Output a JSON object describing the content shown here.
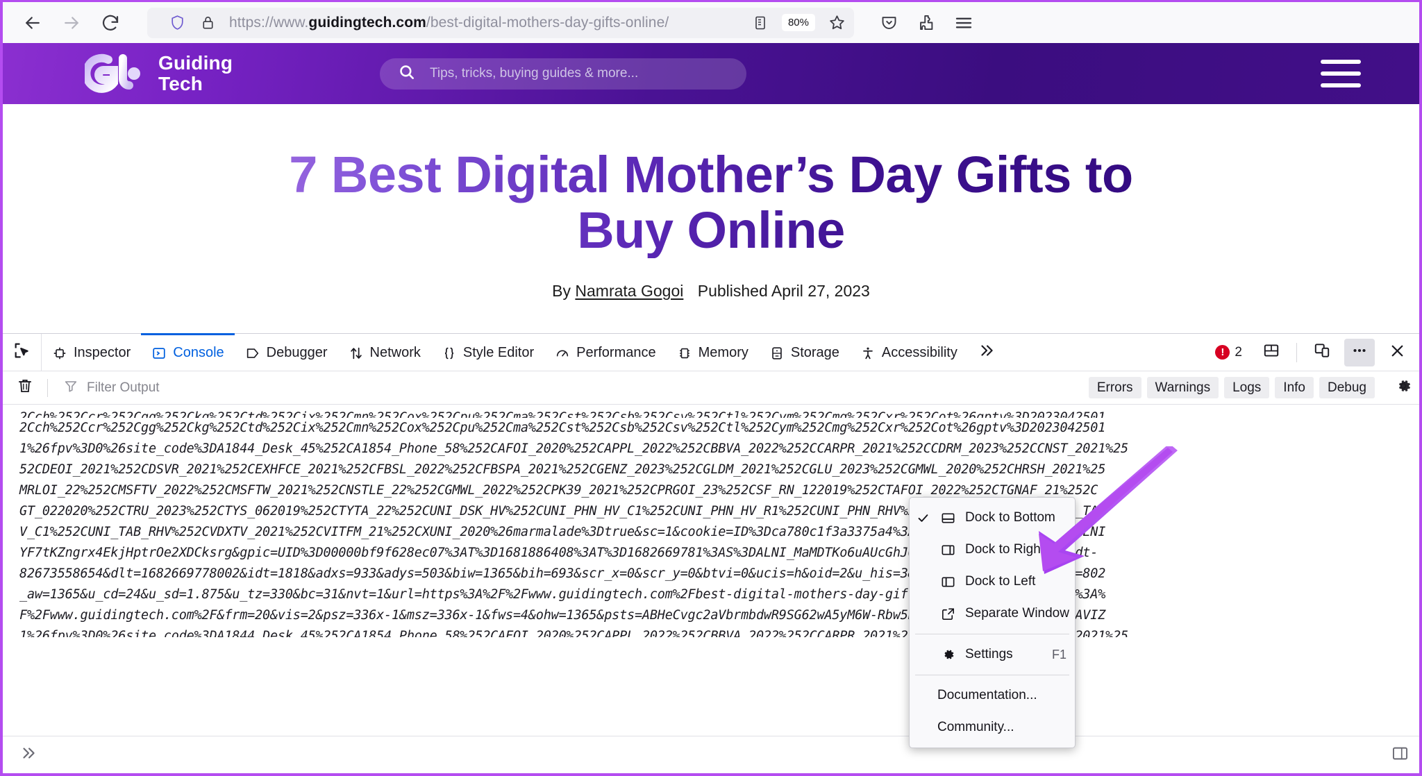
{
  "browser": {
    "back_icon": "back-arrow-icon",
    "forward_icon": "forward-arrow-icon",
    "reload_icon": "reload-icon",
    "shield_icon": "shield-icon",
    "lock_icon": "padlock-icon",
    "url_prefix": "https://www.",
    "url_host": "guidingtech.com",
    "url_path": "/best-digital-mothers-day-gifts-online/",
    "url_full": "https://www.guidingtech.com/best-digital-mothers-day-gifts-online/",
    "reader_icon": "reader-view-icon",
    "zoom_level": "80%",
    "bookmark_icon": "star-icon",
    "pocket_icon": "pocket-icon",
    "extensions_icon": "extensions-icon",
    "menu_icon": "hamburger-menu-icon"
  },
  "site": {
    "logo_name": "guiding-tech-logo",
    "brand_line1": "Guiding",
    "brand_line2": "Tech",
    "search_placeholder": "Tips, tricks, buying guides & more...",
    "search_icon": "search-icon",
    "menu_icon": "hamburger-menu-icon",
    "header_gradient_start": "#8b2fd0",
    "header_gradient_end": "#3b0d80"
  },
  "article": {
    "title": "7 Best Digital Mother’s Day Gifts to Buy Online",
    "by_prefix": "By",
    "author": "Namrata Gogoi",
    "published": "Published April 27, 2023",
    "title_gradient_start": "#9b6ae0",
    "title_gradient_end": "#330a80"
  },
  "devtools": {
    "picker_icon": "element-picker-icon",
    "tabs": [
      {
        "label": "Inspector",
        "icon": "inspector-icon",
        "active": false
      },
      {
        "label": "Console",
        "icon": "console-icon",
        "active": true
      },
      {
        "label": "Debugger",
        "icon": "debugger-icon",
        "active": false
      },
      {
        "label": "Network",
        "icon": "network-icon",
        "active": false
      },
      {
        "label": "Style Editor",
        "icon": "style-editor-icon",
        "active": false
      },
      {
        "label": "Performance",
        "icon": "performance-icon",
        "active": false
      },
      {
        "label": "Memory",
        "icon": "memory-icon",
        "active": false
      },
      {
        "label": "Storage",
        "icon": "storage-icon",
        "active": false
      },
      {
        "label": "Accessibility",
        "icon": "accessibility-icon",
        "active": false
      }
    ],
    "overflow_icon": "chevron-double-right-icon",
    "error_count": "2",
    "error_icon": "error-circle-icon",
    "responsive_icon": "responsive-design-mode-icon",
    "split_console_icon": "split-console-icon",
    "meatball_icon": "more-options-icon",
    "close_icon": "close-icon",
    "accent_active": "#0060df",
    "error_color": "#d70022"
  },
  "console": {
    "clear_icon": "trash-icon",
    "filter_icon": "funnel-icon",
    "filter_placeholder": "Filter Output",
    "filter_value": "",
    "pills": [
      "Errors",
      "Warnings",
      "Logs",
      "Info",
      "Debug"
    ],
    "settings_icon": "gear-icon",
    "prompt_icon": "chevron-double-right-icon",
    "lines": [
      "2Cch%252Ccr%252Cgg%252Ckg%252Ctd%252Cix%252Cmn%252Cox%252Cpu%252Cma%252Cst%252Csb%252Csv%252Ctl%252Cym%252Cmg%252Cxr%252Cot%26gptv%3D2023042501",
      "1%26fpv%3D0%26site_code%3DA1844_Desk_45%252CA1854_Phone_58%252CAFOI_2020%252CAPPL_2022%252CBBVA_2022%252CCARPR_2021%252CCDRM_2023%252CCNST_2021%25",
      "52CDEOI_2021%252CDSVR_2021%252CEXHFCE_2021%252CFBSL_2022%252CFBSPA_2021%252CGENZ_2023%252CGLDM_2021%252CGLU_2023%252CGMWL_2020%252CHRSH_2021%25",
      "MRLOI_22%252CMSFTV_2022%252CMSFTW_2021%252CNSTLE_22%252CGMWL_2022%252CPK39_2021%252CPRGOI_23%252CSF_RN_122019%252CTAFOI_2022%252CTGNAF_21%252C",
      "GT_022020%252CTRU_2023%252CTYS_062019%252CTYTA_22%252CUNI_DSK_HV%252CUNI_PHN_HV_C1%252CUNI_PHN_HV_R1%252CUNI_PHN_RHV%252CUNI_TAB_HV%252CUNI_TAB",
      "V_C1%252CUNI_TAB_RHV%252CVDXTV_2021%252CVITFM_21%252CXUNI_2020%26marmalade%3Dtrue&sc=1&cookie=ID%3Dca780c1f3a3375a4%3AT%3D1681886408%3AS%3DALNI",
      "YF7tKZngrx4EkjHptrOe2XDCksrg&gpic=UID%3D00000bf9f628ec07%3AT%3D1681886408%3AT%3D1682669781%3AS%3DALNI_MaMDTKo6uAUcGhJQso_LX-jVmzOtg&abxe=1&dt-",
      "82673558654&dlt=1682669778002&idt=1818&adxs=933&adys=503&biw=1365&bih=693&scr_x=0&scr_y=0&btvi=0&ucis=h&oid=2&u_his=3&u_h=853&u_w=1365&u_ah=802",
      "_aw=1365&u_cd=24&u_sd=1.875&u_tz=330&bc=31&nvt=1&url=https%3A%2F%2Fwww.guidingtech.com%2Fbest-digital-mothers-day-gifts-online%2F&ref=https%3A%",
      "F%2Fwww.guidingtech.com%2F&frm=20&vis=2&psz=336x-1&msz=336x-1&fws=4&ohw=1365&psts=ABHeCvgc2aVbrmbdwR9SG62wA5yM6W-Rbw5R2l2lW-quwULvshgEq0lhaAVIZ"
    ]
  },
  "context_menu": {
    "items": [
      {
        "label": "Dock to Bottom",
        "icon": "dock-bottom-icon",
        "checked": true,
        "shortcut": ""
      },
      {
        "label": "Dock to Right",
        "icon": "dock-right-icon",
        "checked": false,
        "shortcut": ""
      },
      {
        "label": "Dock to Left",
        "icon": "dock-left-icon",
        "checked": false,
        "shortcut": ""
      },
      {
        "label": "Separate Window",
        "icon": "separate-window-icon",
        "checked": false,
        "shortcut": ""
      },
      {
        "label": "Settings",
        "icon": "gear-icon",
        "checked": false,
        "shortcut": "F1"
      },
      {
        "label": "Documentation...",
        "icon": "",
        "checked": false,
        "shortcut": ""
      },
      {
        "label": "Community...",
        "icon": "",
        "checked": false,
        "shortcut": ""
      }
    ]
  },
  "annotation": {
    "arrow_name": "purple-pointer-arrow",
    "arrow_color": "#b44cf0"
  }
}
